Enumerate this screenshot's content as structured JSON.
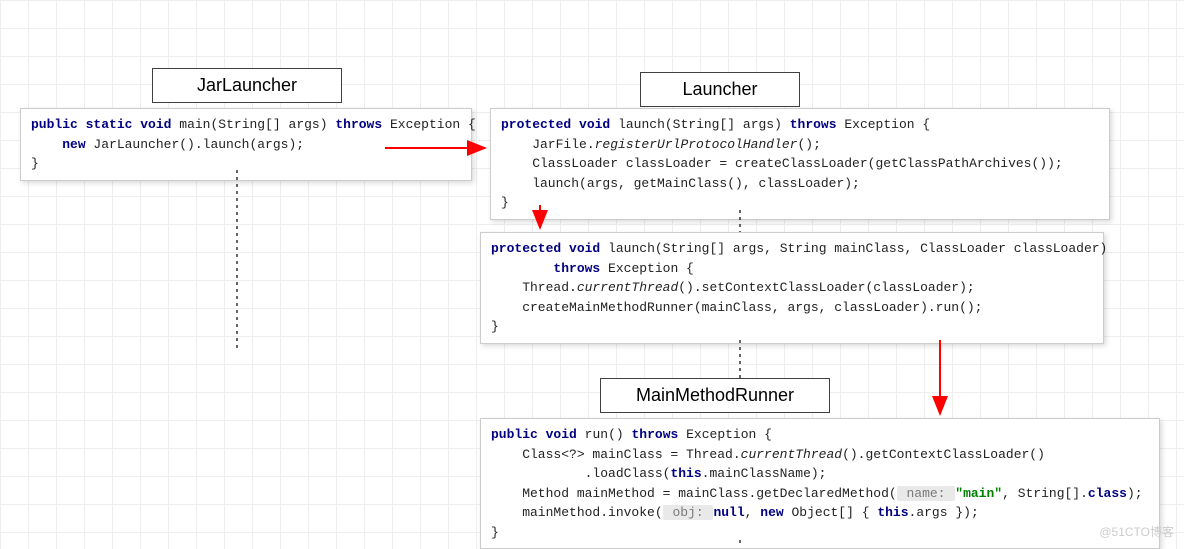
{
  "watermark": "@51CTO博客",
  "titles": {
    "jarlauncher": "JarLauncher",
    "launcher": "Launcher",
    "mainmethodrunner": "MainMethodRunner"
  },
  "code": {
    "jarlauncher": {
      "kw_public": "public",
      "kw_static": "static",
      "kw_void": "void",
      "fn_main": "main",
      "sig_params": "(String[] args)",
      "kw_throws": "throws",
      "ex": "Exception {",
      "kw_new": "new",
      "body_l1": " JarLauncher().launch(args);",
      "close": "}"
    },
    "launcher1": {
      "kw_protected": "protected",
      "kw_void": "void",
      "fn_launch": "launch",
      "sig_params": "(String[] args)",
      "kw_throws": "throws",
      "ex": "Exception {",
      "l1a": "    JarFile.",
      "l1b_it": "registerUrlProtocolHandler",
      "l1c": "();",
      "l2": "    ClassLoader classLoader = createClassLoader(getClassPathArchives());",
      "l3": "    launch(args, getMainClass(), classLoader);",
      "close": "}"
    },
    "launcher2": {
      "kw_protected": "protected",
      "kw_void": "void",
      "fn_launch": "launch",
      "sig_params": "(String[] args, String mainClass, ClassLoader classLoader)",
      "kw_throws": "throws",
      "ex": "Exception {",
      "l1a": "    Thread.",
      "l1b_it": "currentThread",
      "l1c": "().setContextClassLoader(classLoader);",
      "l2": "    createMainMethodRunner(mainClass, args, classLoader).run();",
      "close": "}"
    },
    "mmr": {
      "kw_public": "public",
      "kw_void": "void",
      "fn_run": "run",
      "sig_params": "()",
      "kw_throws": "throws",
      "ex": "Exception {",
      "l1a": "    Class<?> mainClass = Thread.",
      "l1b_it": "currentThread",
      "l1c": "().getContextClassLoader()",
      "l2a": "            .loadClass(",
      "kw_this1": "this",
      "l2b": ".mainClassName);",
      "l3a": "    Method mainMethod = mainClass.getDeclaredMethod(",
      "hint_name": " name: ",
      "str_main": "\"main\"",
      "l3b": ", String[].",
      "kw_class": "class",
      "l3c": ");",
      "l4a": "    mainMethod.invoke(",
      "hint_obj": " obj: ",
      "kw_null": "null",
      "l4b": ", ",
      "kw_new": "new",
      "l4c": " Object[] { ",
      "kw_this2": "this",
      "l4d": ".args });",
      "close": "}"
    }
  }
}
